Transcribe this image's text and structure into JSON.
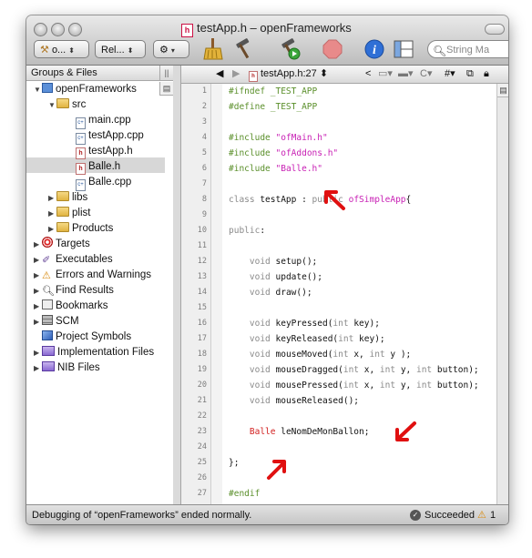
{
  "window": {
    "title": "testApp.h – openFrameworks",
    "file_badge": "h"
  },
  "toolbar": {
    "target_popup": "o...",
    "config_popup": "Rel...",
    "search_placeholder": "String Ma"
  },
  "sidebar": {
    "header": "Groups & Files",
    "items": [
      {
        "label": "openFrameworks",
        "icon": "project-icon"
      },
      {
        "label": "src",
        "icon": "folder-icon"
      },
      {
        "label": "main.cpp",
        "icon": "cpp-file-icon"
      },
      {
        "label": "testApp.cpp",
        "icon": "cpp-file-icon"
      },
      {
        "label": "testApp.h",
        "icon": "header-file-icon"
      },
      {
        "label": "Balle.h",
        "icon": "header-file-icon"
      },
      {
        "label": "Balle.cpp",
        "icon": "cpp-file-icon"
      },
      {
        "label": "libs",
        "icon": "folder-icon"
      },
      {
        "label": "plist",
        "icon": "folder-icon"
      },
      {
        "label": "Products",
        "icon": "folder-icon"
      },
      {
        "label": "Targets",
        "icon": "target-icon"
      },
      {
        "label": "Executables",
        "icon": "executable-icon"
      },
      {
        "label": "Errors and Warnings",
        "icon": "warning-icon"
      },
      {
        "label": "Find Results",
        "icon": "magnifier-icon"
      },
      {
        "label": "Bookmarks",
        "icon": "book-icon"
      },
      {
        "label": "SCM",
        "icon": "scm-icon"
      },
      {
        "label": "Project Symbols",
        "icon": "cube-icon"
      },
      {
        "label": "Implementation Files",
        "icon": "smart-folder-icon"
      },
      {
        "label": "NIB Files",
        "icon": "smart-folder-icon"
      }
    ]
  },
  "editor": {
    "file_popup": "testApp.h:27",
    "lines": [
      {
        "num": "1",
        "code": "#ifndef _TEST_APP"
      },
      {
        "num": "2",
        "code": "#define _TEST_APP"
      },
      {
        "num": "3",
        "code": ""
      },
      {
        "num": "4",
        "code": "#include \"ofMain.h\""
      },
      {
        "num": "5",
        "code": "#include \"ofAddons.h\""
      },
      {
        "num": "6",
        "code": "#include \"Balle.h\""
      },
      {
        "num": "7",
        "code": ""
      },
      {
        "num": "8",
        "code": "class testApp : public ofSimpleApp{"
      },
      {
        "num": "9",
        "code": ""
      },
      {
        "num": "10",
        "code": "public:"
      },
      {
        "num": "11",
        "code": ""
      },
      {
        "num": "12",
        "code": "    void setup();"
      },
      {
        "num": "13",
        "code": "    void update();"
      },
      {
        "num": "14",
        "code": "    void draw();"
      },
      {
        "num": "15",
        "code": ""
      },
      {
        "num": "16",
        "code": "    void keyPressed(int key);"
      },
      {
        "num": "17",
        "code": "    void keyReleased(int key);"
      },
      {
        "num": "18",
        "code": "    void mouseMoved(int x, int y );"
      },
      {
        "num": "19",
        "code": "    void mouseDragged(int x, int y, int button);"
      },
      {
        "num": "20",
        "code": "    void mousePressed(int x, int y, int button);"
      },
      {
        "num": "21",
        "code": "    void mouseReleased();"
      },
      {
        "num": "22",
        "code": ""
      },
      {
        "num": "23",
        "code": "    Balle leNomDeMonBallon;"
      },
      {
        "num": "24",
        "code": ""
      },
      {
        "num": "25",
        "code": "};"
      },
      {
        "num": "26",
        "code": ""
      },
      {
        "num": "27",
        "code": "#endif"
      }
    ]
  },
  "status": {
    "message": "Debugging of “openFrameworks” ended normally.",
    "result": "Succeeded",
    "warning_count": "1"
  },
  "colors": {
    "preprocessor": "#5a8f2a",
    "string": "#c81fb4",
    "keyword": "#8a8a8a",
    "annotation_arrow": "#e01010"
  }
}
